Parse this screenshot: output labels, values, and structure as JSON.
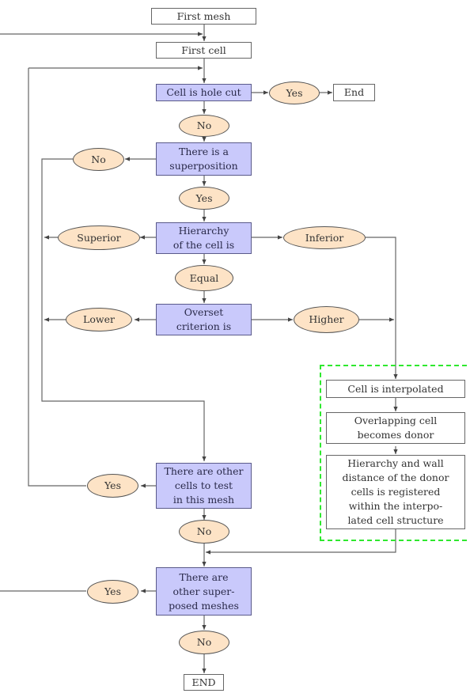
{
  "diagram": {
    "type": "flowchart",
    "colors": {
      "decision_fill": "#c9c9fb",
      "answer_fill": "#fde3c6",
      "process_fill": "#ffffff",
      "group_border": "#2ee82e",
      "line": "#666666"
    },
    "nodes": {
      "first_mesh": "First mesh",
      "first_cell": "First cell",
      "hole_cut": "Cell is hole cut",
      "hole_yes": "Yes",
      "end_top": "End",
      "hole_no": "No",
      "superposition": "There is a\nsuperposition",
      "sup_no": "No",
      "sup_yes": "Yes",
      "hierarchy": "Hierarchy\nof the cell is",
      "superior": "Superior",
      "inferior": "Inferior",
      "equal": "Equal",
      "overset": "Overset\ncriterion is",
      "lower": "Lower",
      "higher": "Higher",
      "interpolated": "Cell is interpolated",
      "donor": "Overlapping cell\nbecomes donor",
      "registered": "Hierarchy and wall\ndistance of the donor\ncells is registered\nwithin the interpo-\nlated cell structure",
      "other_cells": "There are other\ncells to test\nin this mesh",
      "cells_yes": "Yes",
      "cells_no": "No",
      "other_meshes": "There are\nother super-\nposed meshes",
      "meshes_yes": "Yes",
      "meshes_no": "No",
      "end_bottom": "END"
    },
    "edges": [
      [
        "first_mesh",
        "first_cell"
      ],
      [
        "first_cell",
        "hole_cut"
      ],
      [
        "hole_cut",
        "hole_yes"
      ],
      [
        "hole_yes",
        "end_top"
      ],
      [
        "hole_cut",
        "hole_no"
      ],
      [
        "hole_no",
        "superposition"
      ],
      [
        "superposition",
        "sup_no"
      ],
      [
        "sup_no",
        "other_cells"
      ],
      [
        "superposition",
        "sup_yes"
      ],
      [
        "sup_yes",
        "hierarchy"
      ],
      [
        "hierarchy",
        "superior"
      ],
      [
        "superior",
        "other_cells"
      ],
      [
        "hierarchy",
        "inferior"
      ],
      [
        "inferior",
        "interpolated"
      ],
      [
        "hierarchy",
        "equal"
      ],
      [
        "equal",
        "overset"
      ],
      [
        "overset",
        "lower"
      ],
      [
        "lower",
        "other_cells"
      ],
      [
        "overset",
        "higher"
      ],
      [
        "higher",
        "interpolated"
      ],
      [
        "interpolated",
        "donor"
      ],
      [
        "donor",
        "registered"
      ],
      [
        "registered",
        "other_meshes"
      ],
      [
        "other_cells",
        "cells_yes"
      ],
      [
        "cells_yes",
        "hole_cut"
      ],
      [
        "other_cells",
        "cells_no"
      ],
      [
        "cells_no",
        "other_meshes"
      ],
      [
        "other_meshes",
        "meshes_yes"
      ],
      [
        "meshes_yes",
        "first_cell"
      ],
      [
        "other_meshes",
        "meshes_no"
      ],
      [
        "meshes_no",
        "end_bottom"
      ]
    ]
  }
}
